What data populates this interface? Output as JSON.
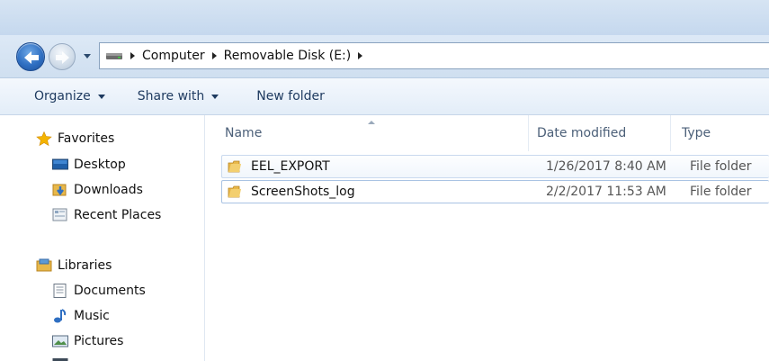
{
  "address": {
    "crumbs": [
      "Computer",
      "Removable Disk (E:)"
    ]
  },
  "toolbar": {
    "organize": "Organize",
    "share_with": "Share with",
    "new_folder": "New folder"
  },
  "navpane": {
    "favorites": "Favorites",
    "desktop": "Desktop",
    "downloads": "Downloads",
    "recent_places": "Recent Places",
    "libraries": "Libraries",
    "documents": "Documents",
    "music": "Music",
    "pictures": "Pictures"
  },
  "columns": {
    "name": "Name",
    "date_modified": "Date modified",
    "type": "Type"
  },
  "files": [
    {
      "name": "EEL_EXPORT",
      "date": "1/26/2017 8:40 AM",
      "type": "File folder"
    },
    {
      "name": "ScreenShots_log",
      "date": "2/2/2017 11:53 AM",
      "type": "File folder"
    }
  ],
  "colors": {
    "accent": "#2f6fc2",
    "toolbar_text": "#1e3a5f",
    "folder": "#e8b84a"
  }
}
